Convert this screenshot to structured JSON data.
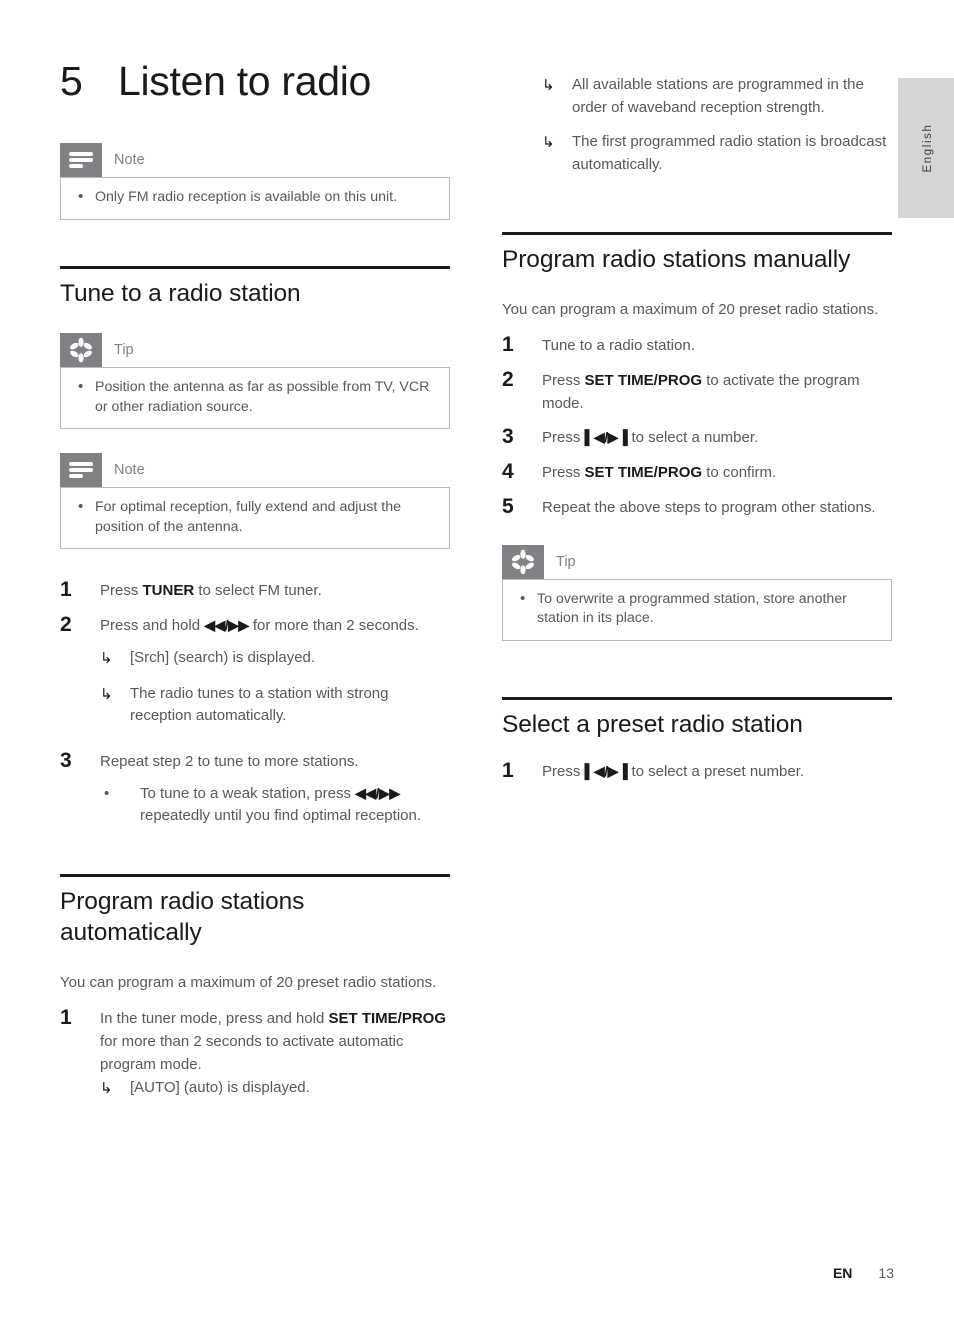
{
  "page": {
    "language_tab": "English",
    "footer_lang_code": "EN",
    "footer_page_number": "13"
  },
  "chapter": {
    "number": "5",
    "title": "Listen to radio"
  },
  "left_column": {
    "note_intro": {
      "badge_icon": "note-icon",
      "label": "Note",
      "bullets": [
        "Only FM radio reception is available on this unit."
      ]
    },
    "section_tune": {
      "heading": "Tune to a radio station",
      "tip": {
        "badge_icon": "tip-icon",
        "label": "Tip",
        "bullets": [
          "Position the antenna as far as possible from TV, VCR or other radiation source."
        ]
      },
      "note": {
        "badge_icon": "note-icon",
        "label": "Note",
        "bullets": [
          "For optimal reception, fully extend and adjust the position of the antenna."
        ]
      },
      "steps": [
        {
          "number": "1",
          "text_before": "Press ",
          "bold": "TUNER",
          "text_after": " to select FM tuner."
        },
        {
          "number": "2",
          "text_before": "Press and hold ",
          "glyph": "◀◀/▶▶",
          "text_after": " for more than 2 seconds.",
          "results": [
            "[Srch] (search) is displayed.",
            "The radio tunes to a station with strong reception automatically."
          ]
        },
        {
          "number": "3",
          "text_before": "Repeat step 2 to tune to more stations.",
          "subbullets": [
            {
              "text_before": "To tune to a weak station, press ",
              "glyph": "◀◀/▶▶",
              "text_after": " repeatedly until you find optimal reception."
            }
          ]
        }
      ]
    },
    "section_auto": {
      "heading": "Program radio stations automatically",
      "paragraph": "You can program a maximum of 20 preset radio stations.",
      "steps": [
        {
          "number": "1",
          "text_before": "In the tuner mode, press and hold ",
          "bold": "SET TIME/PROG",
          "text_after": " for more than 2 seconds to activate automatic program mode.",
          "results": [
            "[AUTO] (auto) is displayed."
          ]
        }
      ]
    }
  },
  "right_column": {
    "continued_results": [
      "All available stations are programmed in the order of waveband reception strength.",
      "The first programmed radio station is broadcast automatically."
    ],
    "section_manual": {
      "heading": "Program radio stations manually",
      "paragraph": "You can program a maximum of 20 preset radio stations.",
      "steps": [
        {
          "number": "1",
          "text_before": "Tune to a radio station."
        },
        {
          "number": "2",
          "text_before": "Press ",
          "bold": "SET TIME/PROG",
          "text_after": " to activate the program mode."
        },
        {
          "number": "3",
          "text_before": "Press ",
          "glyph": "▌◀/▶▐",
          "text_after": " to select a number."
        },
        {
          "number": "4",
          "text_before": "Press ",
          "bold": "SET TIME/PROG",
          "text_after": " to confirm."
        },
        {
          "number": "5",
          "text_before": "Repeat the above steps to program other stations."
        }
      ],
      "tip": {
        "badge_icon": "tip-icon",
        "label": "Tip",
        "bullets": [
          "To overwrite a programmed station, store another station in its place."
        ]
      }
    },
    "section_select": {
      "heading": "Select a preset radio station",
      "steps": [
        {
          "number": "1",
          "text_before": "Press ",
          "glyph": "▌◀/▶▐",
          "text_after": " to select a preset number."
        }
      ]
    }
  },
  "colors": {
    "badge_gray": "#808184",
    "tab_gray": "#d4d5d7",
    "body_text": "#58585a",
    "heading_text": "#1a1a1a",
    "box_border": "#b9babc"
  }
}
